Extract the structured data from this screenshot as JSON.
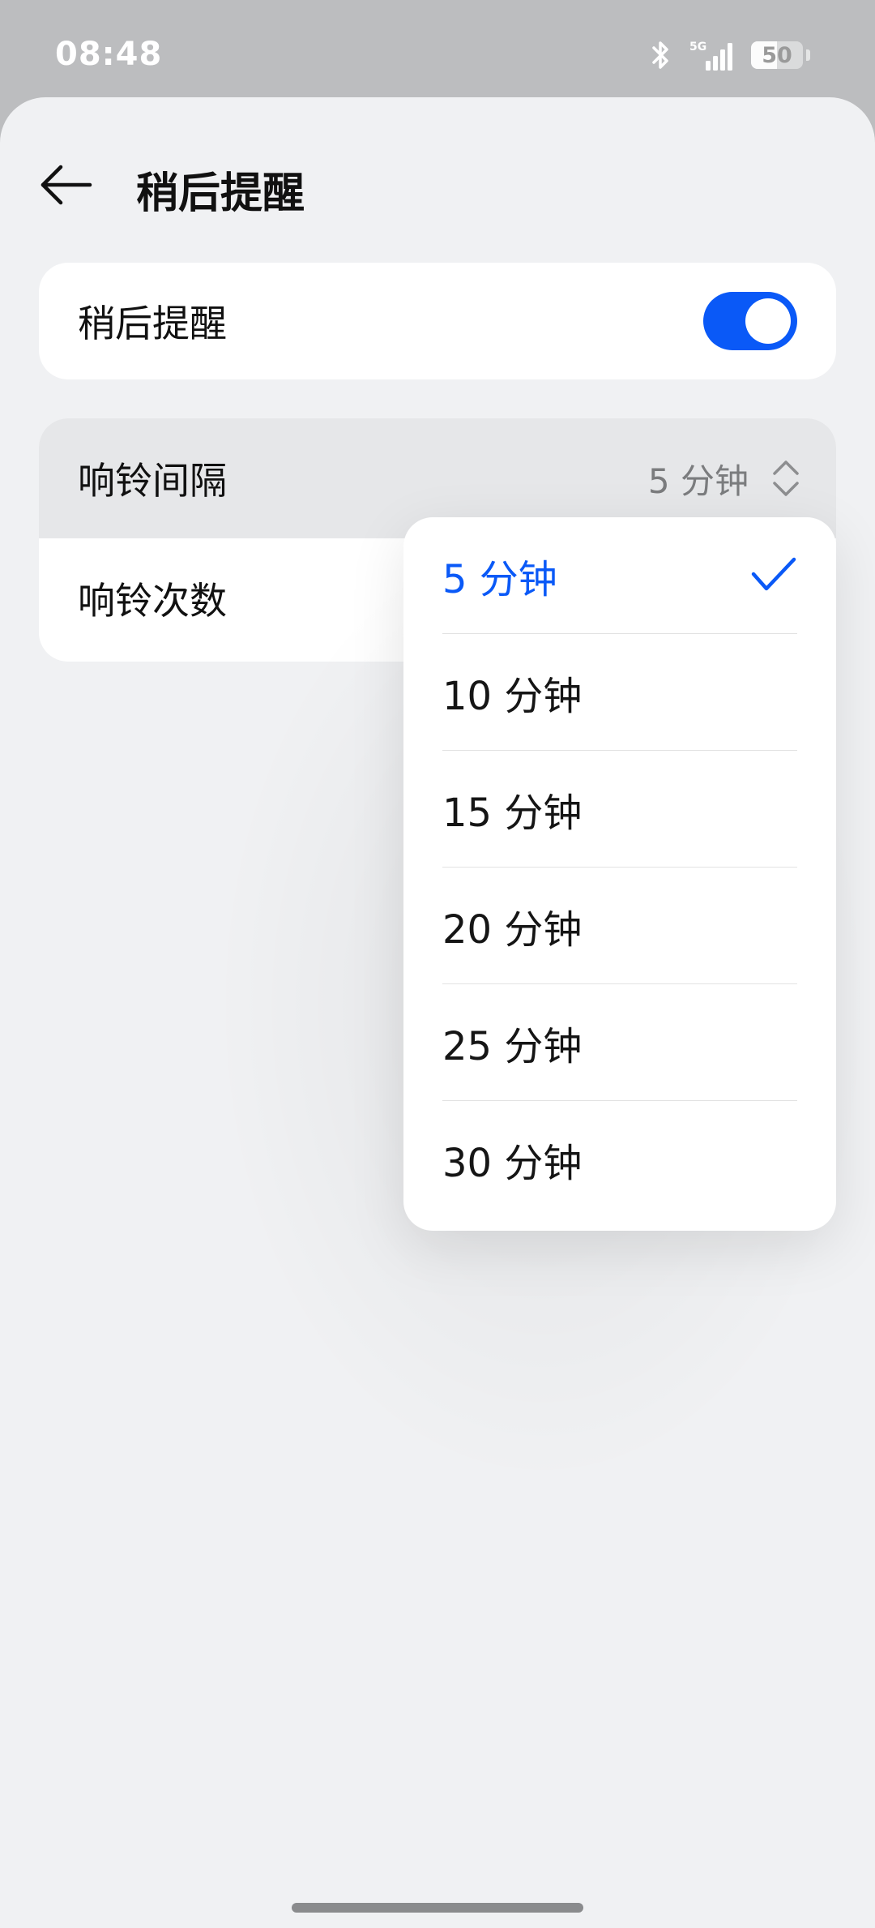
{
  "status_bar": {
    "time": "08:48",
    "network": "5G",
    "battery_level": "50",
    "battery_fraction": 0.5
  },
  "header": {
    "title": "稍后提醒"
  },
  "toggle_card": {
    "label": "稍后提醒",
    "enabled": true
  },
  "ring_card": {
    "interval_label": "响铃间隔",
    "interval_value": "5 分钟",
    "count_label": "响铃次数"
  },
  "dropdown": {
    "options": [
      {
        "label": "5 分钟",
        "selected": true
      },
      {
        "label": "10 分钟",
        "selected": false
      },
      {
        "label": "15 分钟",
        "selected": false
      },
      {
        "label": "20 分钟",
        "selected": false
      },
      {
        "label": "25 分钟",
        "selected": false
      },
      {
        "label": "30 分钟",
        "selected": false
      }
    ]
  },
  "colors": {
    "accent": "#0a59f7",
    "background": "#f0f1f3",
    "status_bar": "#bcbdbf"
  },
  "icons": {
    "back": "back-arrow-icon",
    "bluetooth": "bluetooth-icon",
    "signal": "signal-5g-icon",
    "battery": "battery-icon",
    "updown": "chevron-updown-icon",
    "check": "check-icon"
  }
}
